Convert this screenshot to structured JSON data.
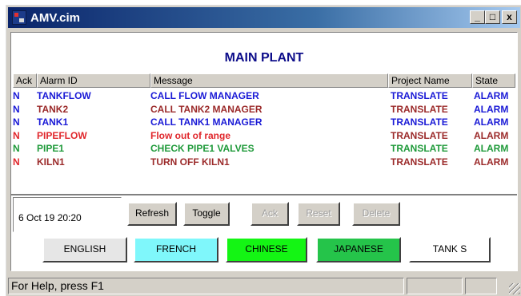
{
  "window": {
    "title": "AMV.cim",
    "minimize": "_",
    "maximize": "□",
    "close": "x"
  },
  "plant_title": "MAIN PLANT",
  "columns": {
    "ack": "Ack",
    "alarm_id": "Alarm ID",
    "message": "Message",
    "project": "Project Name",
    "state": "State"
  },
  "alarms": [
    {
      "ack": "N",
      "id": "TANKFLOW",
      "message": "CALL FLOW MANAGER",
      "project": "TRANSLATE",
      "state": "ALARM",
      "color": "#1a1ad6",
      "ack_color": "#1a1ad6",
      "project_color": "#1a1ad6",
      "state_color": "#1a1ad6"
    },
    {
      "ack": "N",
      "id": "TANK2",
      "message": "CALL TANK2  MANAGER",
      "project": "TRANSLATE",
      "state": "ALARM",
      "color": "#9b2a2a",
      "ack_color": "#1a1ad6",
      "project_color": "#9b2a2a",
      "state_color": "#1a1ad6"
    },
    {
      "ack": "N",
      "id": "TANK1",
      "message": "CALL TANK1 MANAGER",
      "project": "TRANSLATE",
      "state": "ALARM",
      "color": "#1a1ad6",
      "ack_color": "#1a1ad6",
      "project_color": "#1a1ad6",
      "state_color": "#1a1ad6"
    },
    {
      "ack": "N",
      "id": "PIPEFLOW",
      "message": "Flow out of range",
      "project": "TRANSLATE",
      "state": "ALARM",
      "color": "#e0262b",
      "ack_color": "#e0262b",
      "project_color": "#9b2a2a",
      "state_color": "#9b2a2a"
    },
    {
      "ack": "N",
      "id": "PIPE1",
      "message": "CHECK PIPE1 VALVES",
      "project": "TRANSLATE",
      "state": "ALARM",
      "color": "#1f9a3a",
      "ack_color": "#1f9a3a",
      "project_color": "#1f9a3a",
      "state_color": "#1f9a3a"
    },
    {
      "ack": "N",
      "id": "KILN1",
      "message": "TURN OFF KILN1",
      "project": "TRANSLATE",
      "state": "ALARM",
      "color": "#9b2a2a",
      "ack_color": "#e0262b",
      "project_color": "#9b2a2a",
      "state_color": "#9b2a2a"
    }
  ],
  "datetime": "6 Oct 19 20:20",
  "buttons": {
    "refresh": "Refresh",
    "toggle": "Toggle",
    "ack": "Ack",
    "reset": "Reset",
    "delete": "Delete"
  },
  "languages": [
    {
      "label": "ENGLISH",
      "bg": "#e6e6e6"
    },
    {
      "label": "FRENCH",
      "bg": "#7ff7fb"
    },
    {
      "label": "CHINESE",
      "bg": "#14f514"
    },
    {
      "label": "JAPANESE",
      "bg": "#25c44a"
    },
    {
      "label": "TANK S",
      "bg": "#ffffff"
    }
  ],
  "status_text": "For Help, press F1"
}
